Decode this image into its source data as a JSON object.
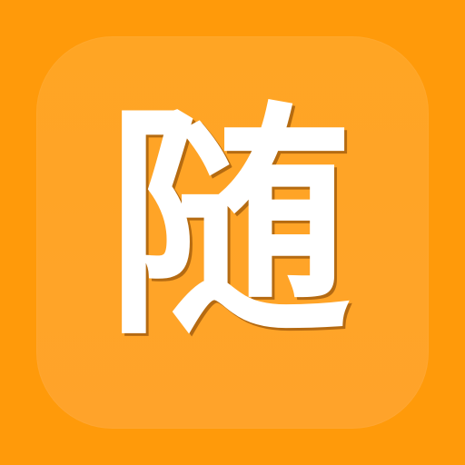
{
  "app_icon": {
    "glyph": "随",
    "background_color": "#ff9a0a",
    "tile_color": "#ffa524",
    "glyph_color": "#ffffff"
  }
}
